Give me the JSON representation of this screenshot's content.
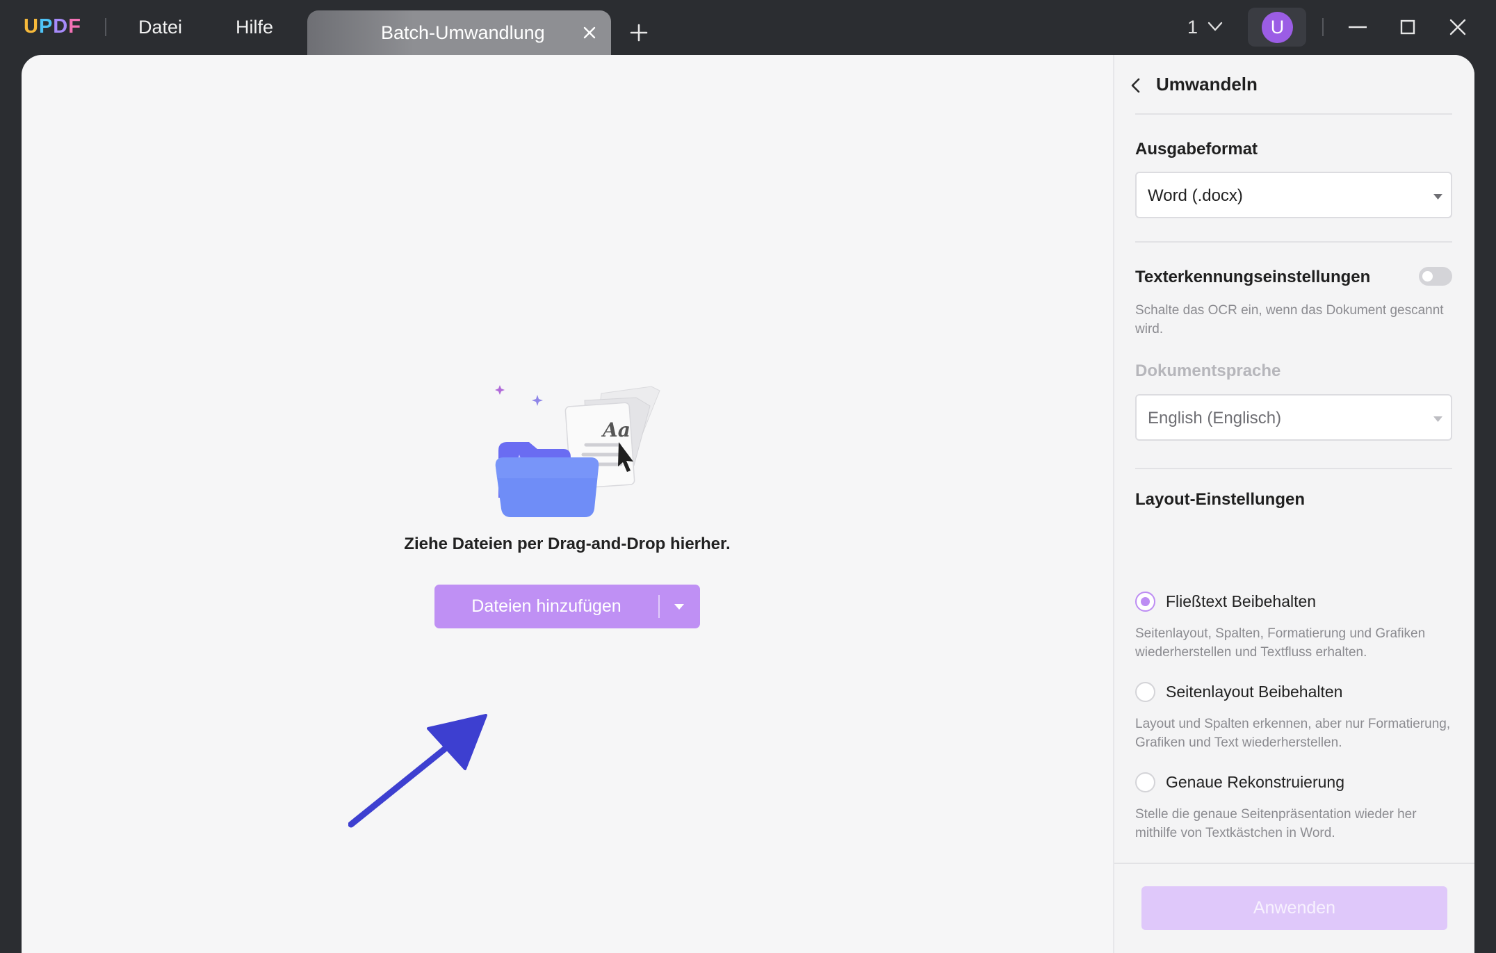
{
  "titlebar": {
    "logo": {
      "u": "U",
      "p": "P",
      "d": "D",
      "f": "F"
    },
    "menu": [
      "Datei",
      "Hilfe"
    ],
    "tab_title": "Batch-Umwandlung",
    "page_number": "1",
    "avatar_letter": "U"
  },
  "dropzone": {
    "instruction": "Ziehe Dateien per Drag-and-Drop hierher.",
    "add_button_label": "Dateien hinzufügen"
  },
  "panel": {
    "title": "Umwandeln",
    "output_format_heading": "Ausgabeformat",
    "output_format_value": "Word (.docx)",
    "ocr_heading": "Texterkennungseinstellungen",
    "ocr_enabled": false,
    "ocr_description": "Schalte das OCR ein, wenn das Dokument gescannt wird.",
    "language_heading": "Dokumentsprache",
    "language_value": "English (Englisch)",
    "layout_heading": "Layout-Einstellungen",
    "layout_options": [
      {
        "label": "Fließtext Beibehalten",
        "description": "Seitenlayout, Spalten, Formatierung und Grafiken wiederherstellen und Textfluss erhalten.",
        "selected": true
      },
      {
        "label": "Seitenlayout Beibehalten",
        "description": "Layout und Spalten erkennen, aber nur Formatierung, Grafiken und Text wiederherstellen.",
        "selected": false
      },
      {
        "label": "Genaue Rekonstruierung",
        "description": "Stelle die genaue Seitenpräsentation wieder her mithilfe von Textkästchen in Word.",
        "selected": false
      }
    ],
    "apply_label": "Anwenden"
  },
  "colors": {
    "accent": "#bf90f4",
    "accent_disabled": "#dfc8fa",
    "titlebar_bg": "#2b2d31",
    "arrow": "#3d3fd0"
  },
  "icons": [
    "updf-logo",
    "close-icon",
    "plus-icon",
    "chevron-down-icon",
    "minimize-icon",
    "maximize-icon",
    "window-close-icon",
    "back-chevron-icon",
    "caret-down-icon",
    "folder-illustration",
    "annotation-arrow"
  ]
}
